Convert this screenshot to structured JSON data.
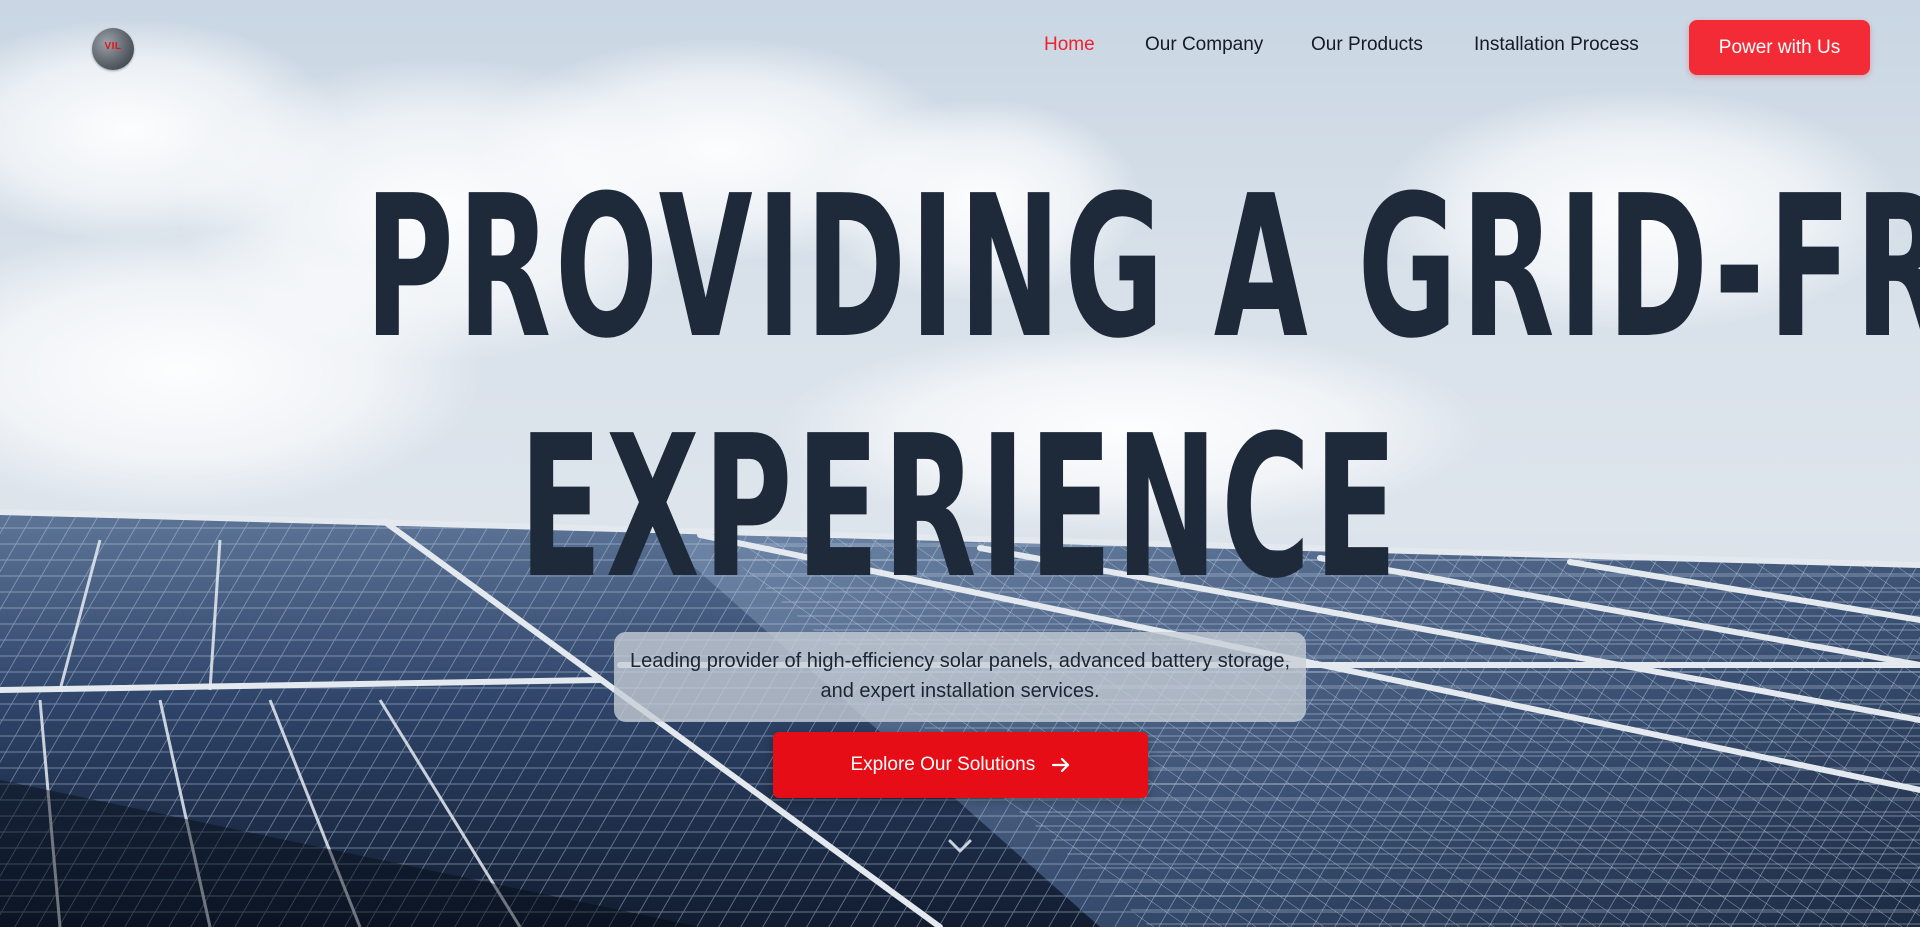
{
  "brand": {
    "logo_text": "VIL"
  },
  "nav": {
    "items": [
      {
        "label": "Home",
        "active": true
      },
      {
        "label": "Our Company",
        "active": false
      },
      {
        "label": "Our Products",
        "active": false
      },
      {
        "label": "Installation Process",
        "active": false
      }
    ],
    "cta_label": "Power with Us"
  },
  "hero": {
    "headline_line1": "PROVIDING A GRID-FREE",
    "headline_line2": "EXPERIENCE",
    "subtitle": "Leading provider of high-efficiency solar panels, advanced battery storage, and expert installation services.",
    "cta_label": "Explore Our Solutions",
    "cta_icon": "arrow-right-icon",
    "scroll_icon": "chevron-down-icon"
  },
  "colors": {
    "accent": "#f22b36",
    "cta_primary": "#e60d16",
    "active_link": "#ef2230",
    "headline": "#1e2939"
  }
}
